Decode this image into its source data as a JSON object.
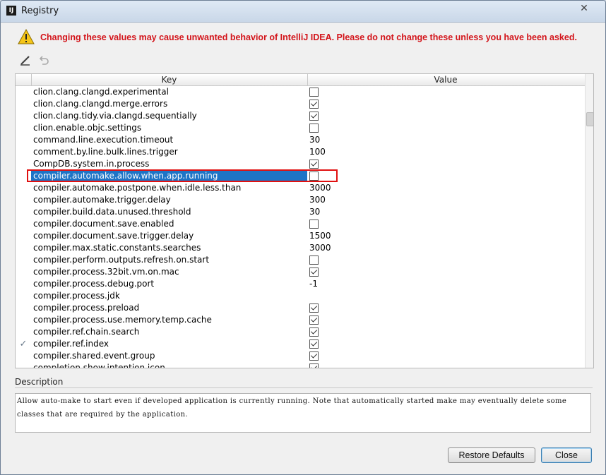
{
  "window": {
    "title": "Registry",
    "app_icon": "intellij-icon",
    "close_icon": "close-icon"
  },
  "warning": {
    "icon": "warning-triangle-icon",
    "text": "Changing these values may cause unwanted behavior of IntelliJ IDEA. Please do not change these unless you have been asked.",
    "color": "#d3141a"
  },
  "toolbar": {
    "edit_icon": "edit-pencil-icon",
    "revert_icon": "revert-undo-icon"
  },
  "table": {
    "columns": [
      "Key",
      "Value"
    ],
    "selected_key": "compiler.automake.allow.when.app.running",
    "rows": [
      {
        "mark": "",
        "key": "clion.clang.clangd.experimental",
        "type": "bool",
        "value": "",
        "checked": false
      },
      {
        "mark": "",
        "key": "clion.clang.clangd.merge.errors",
        "type": "bool",
        "value": "",
        "checked": true
      },
      {
        "mark": "",
        "key": "clion.clang.tidy.via.clangd.sequentially",
        "type": "bool",
        "value": "",
        "checked": true
      },
      {
        "mark": "",
        "key": "clion.enable.objc.settings",
        "type": "bool",
        "value": "",
        "checked": false
      },
      {
        "mark": "",
        "key": "command.line.execution.timeout",
        "type": "text",
        "value": "30",
        "checked": false
      },
      {
        "mark": "",
        "key": "comment.by.line.bulk.lines.trigger",
        "type": "text",
        "value": "100",
        "checked": false
      },
      {
        "mark": "",
        "key": "CompDB.system.in.process",
        "type": "bool",
        "value": "",
        "checked": true
      },
      {
        "mark": "",
        "key": "compiler.automake.allow.when.app.running",
        "type": "bool",
        "value": "",
        "checked": false,
        "selected": true
      },
      {
        "mark": "",
        "key": "compiler.automake.postpone.when.idle.less.than",
        "type": "text",
        "value": "3000",
        "checked": false
      },
      {
        "mark": "",
        "key": "compiler.automake.trigger.delay",
        "type": "text",
        "value": "300",
        "checked": false
      },
      {
        "mark": "",
        "key": "compiler.build.data.unused.threshold",
        "type": "text",
        "value": "30",
        "checked": false
      },
      {
        "mark": "",
        "key": "compiler.document.save.enabled",
        "type": "bool",
        "value": "",
        "checked": false
      },
      {
        "mark": "",
        "key": "compiler.document.save.trigger.delay",
        "type": "text",
        "value": "1500",
        "checked": false
      },
      {
        "mark": "",
        "key": "compiler.max.static.constants.searches",
        "type": "text",
        "value": "3000",
        "checked": false
      },
      {
        "mark": "",
        "key": "compiler.perform.outputs.refresh.on.start",
        "type": "bool",
        "value": "",
        "checked": false
      },
      {
        "mark": "",
        "key": "compiler.process.32bit.vm.on.mac",
        "type": "bool",
        "value": "",
        "checked": true
      },
      {
        "mark": "",
        "key": "compiler.process.debug.port",
        "type": "text",
        "value": "-1",
        "checked": false
      },
      {
        "mark": "",
        "key": "compiler.process.jdk",
        "type": "text",
        "value": "",
        "checked": false
      },
      {
        "mark": "",
        "key": "compiler.process.preload",
        "type": "bool",
        "value": "",
        "checked": true
      },
      {
        "mark": "",
        "key": "compiler.process.use.memory.temp.cache",
        "type": "bool",
        "value": "",
        "checked": true
      },
      {
        "mark": "",
        "key": "compiler.ref.chain.search",
        "type": "bool",
        "value": "",
        "checked": true
      },
      {
        "mark": "✓",
        "key": "compiler.ref.index",
        "type": "bool",
        "value": "",
        "checked": true
      },
      {
        "mark": "",
        "key": "compiler.shared.event.group",
        "type": "bool",
        "value": "",
        "checked": true
      },
      {
        "mark": "",
        "key": "completion.show.intention.icon",
        "type": "bool",
        "value": "",
        "checked": true
      }
    ]
  },
  "description": {
    "label": "Description",
    "text": "Allow auto-make to start even if developed application is currently running. Note that automatically started make may eventually delete some classes that are required by the application."
  },
  "buttons": {
    "restore": "Restore Defaults",
    "close": "Close"
  }
}
